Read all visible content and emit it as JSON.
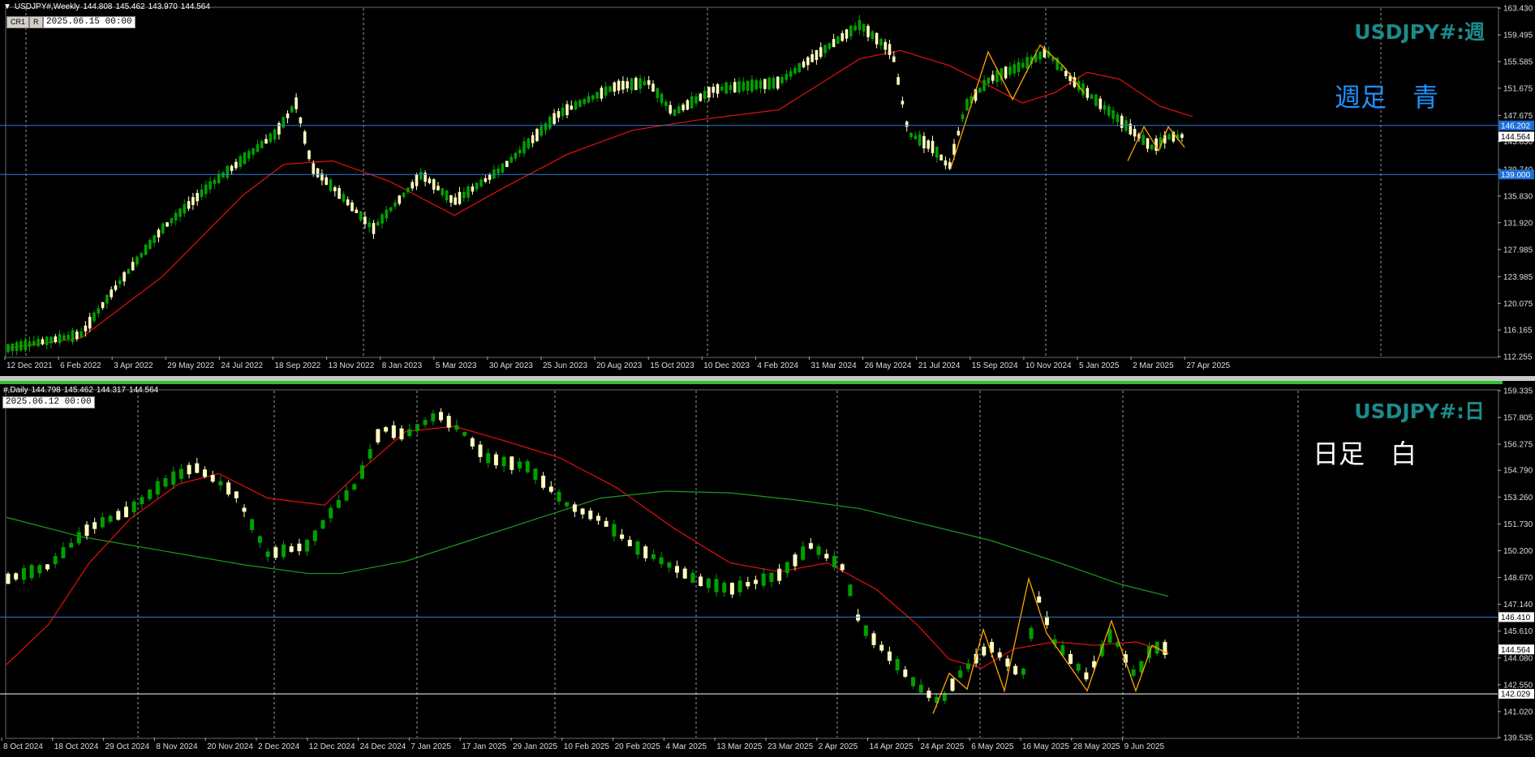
{
  "weekly": {
    "header": {
      "symbol": "USDJPY#,Weekly",
      "open": "144.808",
      "high": "145.462",
      "low": "143.970",
      "close": "144.564"
    },
    "date_box": "2025.06.15 00:00",
    "buttons": [
      "CR1",
      "R"
    ],
    "title": "USDJPY#:週",
    "note": "週足　青",
    "note_color": "#1e90ff",
    "price_min": 112.255,
    "price_max": 163.43,
    "price_ticks": [
      "163.430",
      "159.495",
      "155.585",
      "151.675",
      "147.675",
      "143.830",
      "139.740",
      "135.830",
      "131.920",
      "127.985",
      "123.985",
      "120.075",
      "116.165",
      "112.255"
    ],
    "price_tags": [
      {
        "value": "146.202",
        "bg": "#1a6fd8",
        "color": "#fff"
      },
      {
        "value": "144.564",
        "bg": "#ffffff",
        "color": "#000"
      },
      {
        "value": "139.000",
        "bg": "#1a6fd8",
        "color": "#fff"
      }
    ],
    "hlines": [
      146.202,
      139.0
    ],
    "date_ticks": [
      "12 Dec 2021",
      "6 Feb 2022",
      "3 Apr 2022",
      "29 May 2022",
      "24 Jul 2022",
      "18 Sep 2022",
      "13 Nov 2022",
      "8 Jan 2023",
      "5 Mar 2023",
      "30 Apr 2023",
      "25 Jun 2023",
      "20 Aug 2023",
      "15 Oct 2023",
      "10 Dec 2023",
      "4 Feb 2024",
      "31 Mar 2024",
      "26 May 2024",
      "21 Jul 2024",
      "15 Sep 2024",
      "10 Nov 2024",
      "5 Jan 2025",
      "2 Mar 2025",
      "27 Apr 2025"
    ]
  },
  "daily": {
    "header": {
      "symbol": "#,Daily",
      "open": "144.798",
      "high": "145.462",
      "low": "144.317",
      "close": "144.564"
    },
    "date_box": "2025.06.12 00:00",
    "title": "USDJPY#:日",
    "note": "日足　白",
    "note_color": "#ffffff",
    "price_min": 139.535,
    "price_max": 159.335,
    "price_ticks": [
      "159.335",
      "157.805",
      "156.275",
      "154.790",
      "153.260",
      "151.730",
      "150.200",
      "148.670",
      "147.140",
      "145.610",
      "144.080",
      "142.550",
      "141.020",
      "139.535"
    ],
    "price_tags": [
      {
        "value": "146.410",
        "bg": "#ffffff",
        "color": "#000"
      },
      {
        "value": "144.564",
        "bg": "#ffffff",
        "color": "#000"
      },
      {
        "value": "142.029",
        "bg": "#ffffff",
        "color": "#000"
      }
    ],
    "hlines": [
      146.41,
      142.029
    ],
    "date_ticks": [
      "8 Oct 2024",
      "18 Oct 2024",
      "29 Oct 2024",
      "8 Nov 2024",
      "20 Nov 2024",
      "2 Dec 2024",
      "12 Dec 2024",
      "24 Dec 2024",
      "7 Jan 2025",
      "17 Jan 2025",
      "29 Jan 2025",
      "10 Feb 2025",
      "20 Feb 2025",
      "4 Mar 2025",
      "13 Mar 2025",
      "23 Mar 2025",
      "2 Apr 2025",
      "14 Apr 2025",
      "24 Apr 2025",
      "6 May 2025",
      "16 May 2025",
      "28 May 2025",
      "9 Jun 2025"
    ]
  },
  "colors": {
    "bull": "#00a000",
    "bear": "#ffffc0",
    "ma_red": "#e81010",
    "ma_green": "#1f9a1f",
    "zigzag": "#ffa500",
    "grid": "#9a9a9a"
  }
}
